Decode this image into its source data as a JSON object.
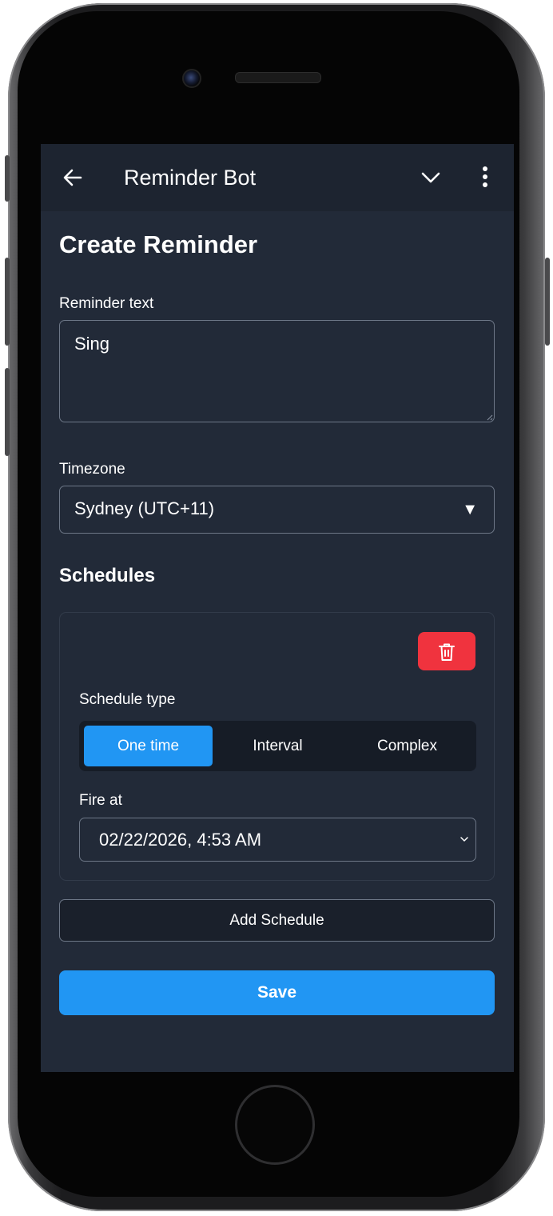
{
  "header": {
    "title": "Reminder Bot"
  },
  "page": {
    "title": "Create Reminder"
  },
  "reminder_text": {
    "label": "Reminder text",
    "value": "Sing"
  },
  "timezone": {
    "label": "Timezone",
    "value": "Sydney (UTC+11)",
    "caret": "▼"
  },
  "schedules": {
    "title": "Schedules",
    "items": [
      {
        "type_label": "Schedule type",
        "options": [
          "One time",
          "Interval",
          "Complex"
        ],
        "selected": "One time",
        "fire_label": "Fire at",
        "fire_value": "02/22/2026, 4:53 AM"
      }
    ],
    "add_label": "Add Schedule"
  },
  "save_label": "Save",
  "colors": {
    "accent": "#2196f3",
    "danger": "#f0333e",
    "background": "#222a38",
    "header": "#1d2430"
  },
  "icons": {
    "back": "arrow-left-icon",
    "collapse": "chevron-down-icon",
    "menu": "more-vertical-icon",
    "delete": "trash-icon"
  }
}
